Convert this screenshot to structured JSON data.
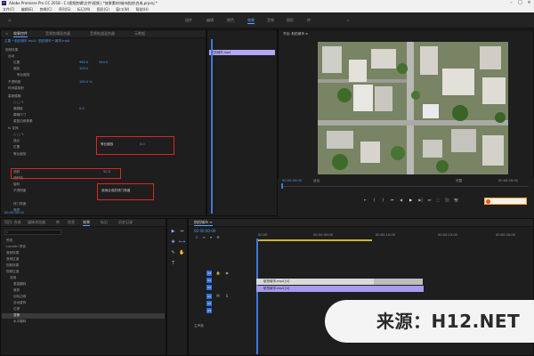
{
  "app": {
    "title": "Adobe Premiere Pro CC 2018 - C:\\视频剪辑\\文件\\视频 | *效果素材\\城市航拍\\合成.prproj *",
    "icon": "Pr"
  },
  "menu": [
    "文件(F)",
    "编辑(E)",
    "剪辑(C)",
    "序列(S)",
    "标记(M)",
    "图形(G)",
    "窗口(W)",
    "帮助(H)"
  ],
  "workspaces": {
    "items": [
      "组件",
      "编辑",
      "颜色",
      "效果",
      "音频",
      "图形",
      "库",
      "»"
    ],
    "active_index": 3
  },
  "effect_controls": {
    "tabs": [
      "效果控件",
      "音频剪辑混合器",
      "音频轨道混合器",
      "元数据"
    ],
    "source_path": "主要 * 航拍城市.mp4 · 航拍城市 * 城市.mp4",
    "rows": [
      "视频效果",
      "运动",
      "位置",
      "缩放",
      "等比缩放",
      "不透明度",
      "时间重映射",
      "高斯模糊",
      "○ □ ✎",
      "模糊度",
      "模糊尺寸",
      "重复边缘像素",
      "fx 变换",
      "○ □ ✎",
      "锚点",
      "位置",
      "等比缩放",
      "倾斜",
      "倾斜轴",
      "旋转",
      "不透明度",
      "快门角度",
      "采样"
    ],
    "values": [
      "960.0",
      "540.0",
      "100.0",
      "100.0 %",
      "0.0",
      "50.0",
      "0.0",
      "0.0"
    ],
    "highlight_value": "0.0",
    "checkbox_labels": [
      "等比缩放",
      "使用合成的快门角度"
    ],
    "timecode": "00:00:00:00"
  },
  "ec_timeline": {
    "clip_label": "航拍城市.mp4"
  },
  "program_monitor": {
    "title": "节目: 航拍城市 ≡",
    "timecode_left": "00:00:00:00",
    "fit_label": "适合",
    "quality_label": "完整",
    "timecode_right": "00:00:20:00",
    "controls": [
      "⇤",
      "{",
      "}",
      "⏮",
      "◀",
      "▶",
      "▶|",
      "⏭",
      "⬚",
      "⬛",
      "📷",
      "+"
    ]
  },
  "project_panel": {
    "tabs": [
      "项目: 合成",
      "媒体浏览器",
      "库",
      "信息",
      "效果",
      "标记",
      "历史记录"
    ],
    "search_placeholder": "",
    "items": [
      "预设",
      "Lumetri 预设",
      "音频效果",
      "音频过渡",
      "视频效果",
      "视频过渡",
      "变换",
      "垂直翻转",
      "裁剪",
      "羽化边缘",
      "自动重构",
      "位移",
      "变换",
      "水平翻转"
    ],
    "selected_item": "变换"
  },
  "timeline": {
    "title": "航拍城市 ≡",
    "timecode": "00:00:00:00",
    "ruler_labels": [
      "00:00",
      "00:00:05:00",
      "00:00:10:00",
      "00:00:15:00",
      "00:00:20:00"
    ],
    "tracks": [
      "V3",
      "V2",
      "V1",
      "A1",
      "A2",
      "A3"
    ],
    "clips": [
      {
        "label": "航拍城市.mp4 [V]",
        "track": "V1",
        "color": "#d9d9d9"
      },
      {
        "label": "航拍城市.mp4 [V]",
        "track": "V1b",
        "color": "#a99af0"
      }
    ],
    "master_label": "主声道"
  },
  "tools": [
    "▶",
    "⇔",
    "✥",
    "⟷",
    "✎",
    "✋",
    "T"
  ],
  "watermark": {
    "text": "来源：H12.NET"
  },
  "colors": {
    "accent": "#5aa7ff",
    "clip_purple": "#a99af0",
    "highlight": "#e02525"
  }
}
